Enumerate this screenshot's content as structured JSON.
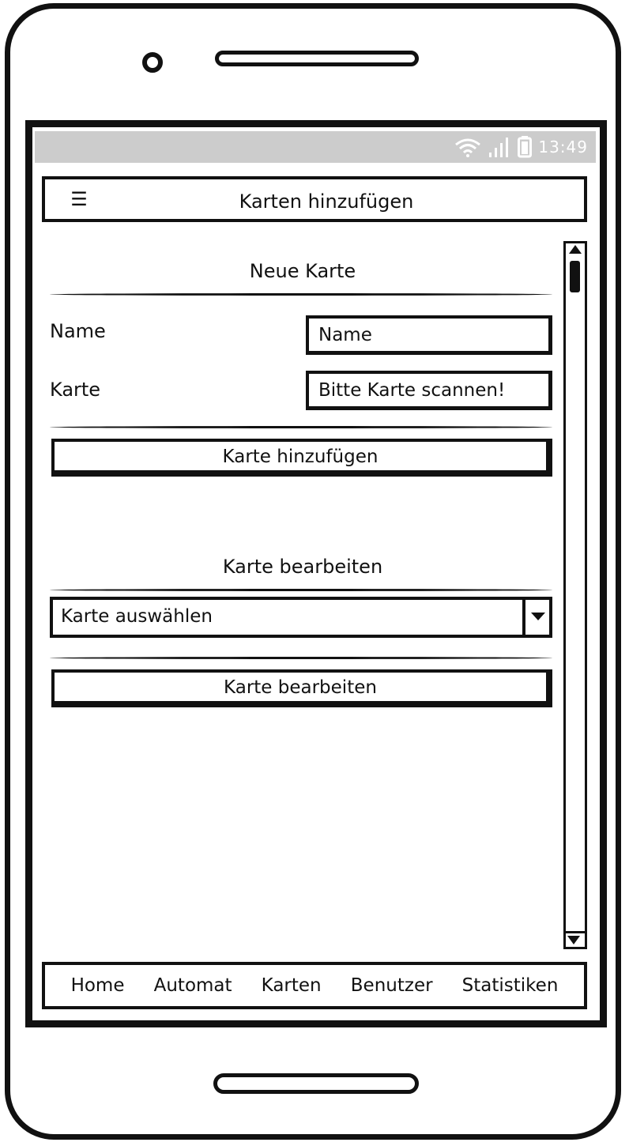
{
  "status_bar": {
    "time": "13:49",
    "icons": [
      "wifi-icon",
      "signal-icon",
      "battery-icon"
    ]
  },
  "header": {
    "menu_icon": "hamburger-menu-icon",
    "title": "Karten hinzufügen"
  },
  "new_card": {
    "title": "Neue Karte",
    "name_label": "Name",
    "name_placeholder": "Name",
    "card_label": "Karte",
    "card_placeholder": "Bitte Karte scannen!",
    "add_button": "Karte hinzufügen"
  },
  "edit_card": {
    "title": "Karte bearbeiten",
    "select_value": "Karte auswählen",
    "edit_button": "Karte bearbeiten"
  },
  "bottom_nav": {
    "items": [
      "Home",
      "Automat",
      "Karten",
      "Benutzer",
      "Statistiken"
    ]
  },
  "colors": {
    "ink": "#111111",
    "status_bar": "#cccccc",
    "background": "#ffffff"
  }
}
